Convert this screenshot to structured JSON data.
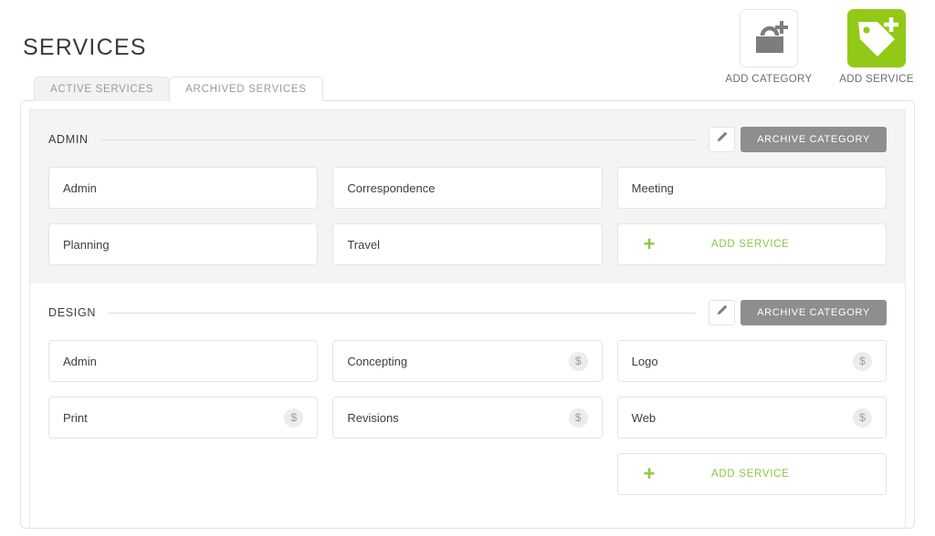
{
  "header": {
    "title": "SERVICES",
    "actions": [
      {
        "label": "ADD CATEGORY",
        "icon": "briefcase-plus-icon",
        "style": "light"
      },
      {
        "label": "ADD SERVICE",
        "icon": "tag-plus-icon",
        "style": "green"
      }
    ]
  },
  "tabs": [
    {
      "label": "ACTIVE SERVICES",
      "active": false
    },
    {
      "label": "ARCHIVED SERVICES",
      "active": true
    }
  ],
  "buttons": {
    "archive_category": "ARCHIVE CATEGORY",
    "edit_icon": "pencil-icon",
    "add_service": "ADD SERVICE",
    "plus": "+"
  },
  "badges": {
    "money": "$"
  },
  "colors": {
    "accent_green": "#8cc63f",
    "tile_green": "#92c916",
    "archive_gray": "#8e8e8e",
    "shaded_row": "#f4f4f4"
  },
  "categories": [
    {
      "name": "ADMIN",
      "shaded": true,
      "services": [
        {
          "name": "Admin",
          "billable": false
        },
        {
          "name": "Correspondence",
          "billable": false
        },
        {
          "name": "Meeting",
          "billable": false
        },
        {
          "name": "Planning",
          "billable": false
        },
        {
          "name": "Travel",
          "billable": false
        }
      ]
    },
    {
      "name": "DESIGN",
      "shaded": false,
      "services": [
        {
          "name": "Admin",
          "billable": false
        },
        {
          "name": "Concepting",
          "billable": true
        },
        {
          "name": "Logo",
          "billable": true
        },
        {
          "name": "Print",
          "billable": true
        },
        {
          "name": "Revisions",
          "billable": true
        },
        {
          "name": "Web",
          "billable": true
        }
      ]
    }
  ]
}
